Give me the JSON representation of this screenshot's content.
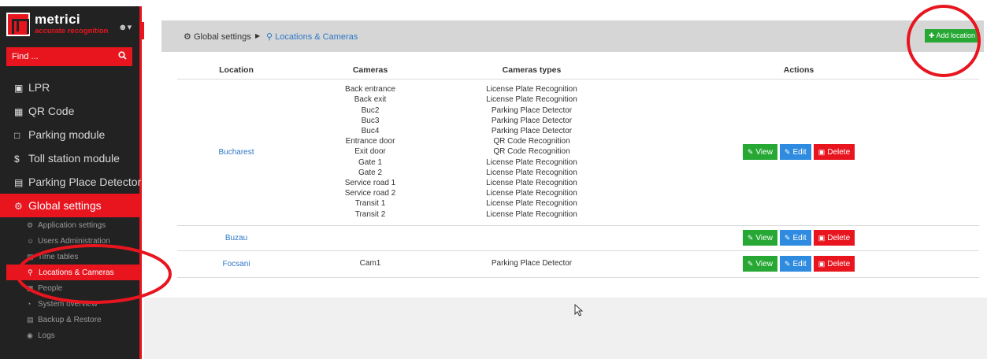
{
  "sidebar": {
    "logo_name": "metrici",
    "logo_tagline": "accurate recognition",
    "user_menu_icon": "user-icon",
    "search": {
      "placeholder": "Find ...",
      "icon": "search-icon"
    },
    "menu": [
      {
        "label": "LPR",
        "icon": "video-camera-icon"
      },
      {
        "label": "QR Code",
        "icon": "qr-code-icon"
      },
      {
        "label": "Parking module",
        "icon": "parking-icon"
      },
      {
        "label": "Toll station module",
        "icon": "dollar-icon"
      },
      {
        "label": "Parking Place Detector",
        "icon": "car-icon"
      },
      {
        "label": "Global settings",
        "icon": "gears-icon",
        "active": true
      }
    ],
    "submenu": [
      {
        "label": "Application settings",
        "icon": "gear-icon"
      },
      {
        "label": "Users Administration",
        "icon": "users-icon"
      },
      {
        "label": "Time tables",
        "icon": "calendar-icon"
      },
      {
        "label": "Locations & Cameras",
        "icon": "map-marker-icon",
        "active": true
      },
      {
        "label": "People",
        "icon": "id-card-icon"
      },
      {
        "label": "System overview",
        "icon": "dashboard-icon"
      },
      {
        "label": "Backup & Restore",
        "icon": "database-icon"
      },
      {
        "label": "Logs",
        "icon": "eye-icon"
      }
    ]
  },
  "breadcrumb": {
    "global": "Global settings",
    "current": "Locations & Cameras"
  },
  "add_location_label": "Add location",
  "table": {
    "headers": {
      "location": "Location",
      "cameras": "Cameras",
      "types": "Cameras types",
      "actions": "Actions"
    },
    "rows": [
      {
        "location": "Bucharest",
        "cameras": [
          "Back entrance",
          "Back exit",
          "Buc2",
          "Buc3",
          "Buc4",
          "Entrance door",
          "Exit door",
          "Gate 1",
          "Gate 2",
          "Service road 1",
          "Service road 2",
          "Transit 1",
          "Transit 2"
        ],
        "types": [
          "License Plate Recognition",
          "License Plate Recognition",
          "Parking Place Detector",
          "Parking Place Detector",
          "Parking Place Detector",
          "QR Code Recognition",
          "QR Code Recognition",
          "License Plate Recognition",
          "License Plate Recognition",
          "License Plate Recognition",
          "License Plate Recognition",
          "License Plate Recognition",
          "License Plate Recognition"
        ]
      },
      {
        "location": "Buzau",
        "cameras": [],
        "types": []
      },
      {
        "location": "Focsani",
        "cameras": [
          "Cam1"
        ],
        "types": [
          "Parking Place Detector"
        ]
      }
    ],
    "action_labels": {
      "view": "View",
      "edit": "Edit",
      "delete": "Delete"
    }
  },
  "colors": {
    "brand_red": "#e8151f",
    "green": "#27a834",
    "blue": "#2e8be0",
    "link": "#2e78c7",
    "sidebar_bg": "#222222"
  }
}
